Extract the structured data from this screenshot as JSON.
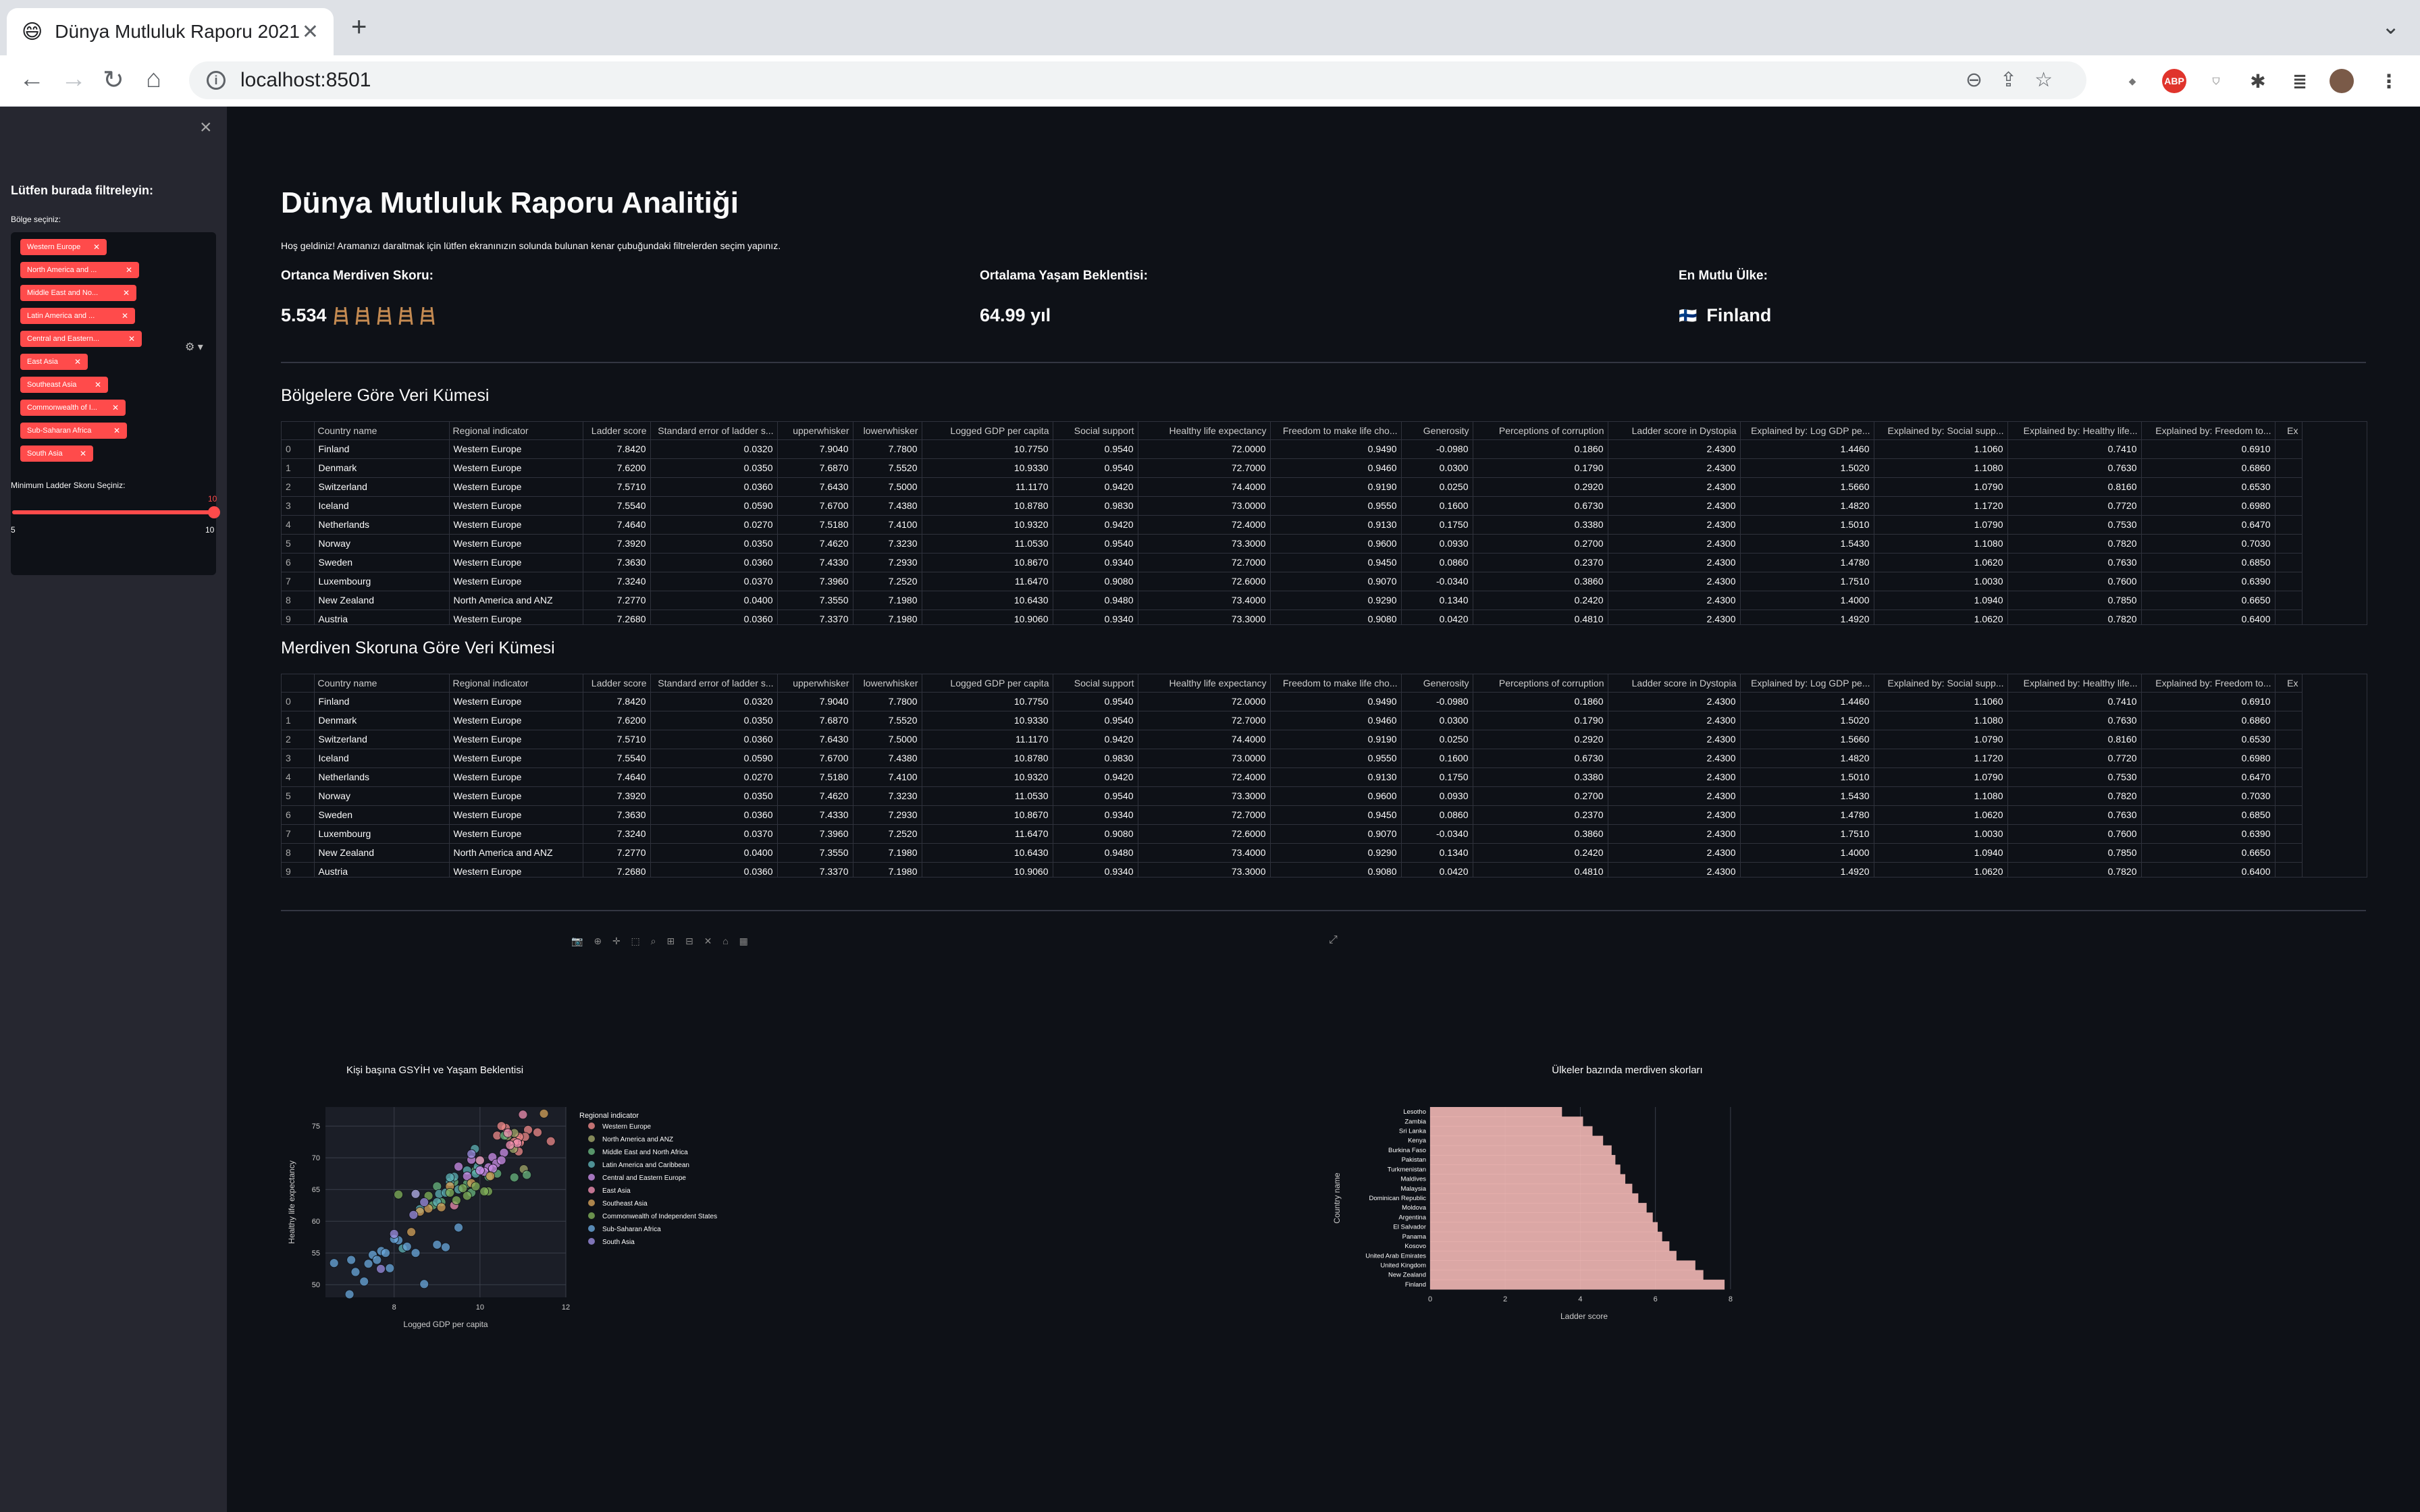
{
  "browser": {
    "tab_title": "Dünya Mutluluk Raporu 2021",
    "tab_favicon": "😄",
    "url": "localhost:8501",
    "ext_abp": "ABP"
  },
  "sidebar": {
    "title": "Lütfen burada filtreleyin:",
    "region_label": "Bölge seçiniz:",
    "regions": [
      "Western Europe",
      "North America and ...",
      "Middle East and No...",
      "Latin America and ...",
      "Central and Eastern...",
      "East Asia",
      "Southeast Asia",
      "Commonwealth of I...",
      "Sub-Saharan Africa",
      "South Asia"
    ],
    "ladder_label": "Minimum Ladder Skoru Seçiniz:",
    "slider_value": "10",
    "slider_min": "5",
    "slider_max": "10"
  },
  "main": {
    "title": "Dünya Mutluluk Raporu Analitiği",
    "welcome": "Hoş geldiniz! Aramanızı daraltmak için lütfen ekranınızın solunda bulunan kenar çubuğundaki filtrelerden seçim yapınız.",
    "kpi1_label": "Ortanca Merdiven Skoru:",
    "kpi1_value": "5.534",
    "kpi2_label": "Ortalama Yaşam Beklentisi:",
    "kpi2_value": "64.99 yıl",
    "kpi3_label": "En Mutlu Ülke:",
    "kpi3_flag": "🇫🇮",
    "kpi3_value": "Finland",
    "table1_title": "Bölgelere Göre Veri Kümesi",
    "table2_title": "Merdiven Skoruna Göre Veri Kümesi"
  },
  "table": {
    "columns": [
      "",
      "Country name",
      "Regional indicator",
      "Ladder score",
      "Standard error of ladder s...",
      "upperwhisker",
      "lowerwhisker",
      "Logged GDP per capita",
      "Social support",
      "Healthy life expectancy",
      "Freedom to make life cho...",
      "Generosity",
      "Perceptions of corruption",
      "Ladder score in Dystopia",
      "Explained by: Log GDP pe...",
      "Explained by: Social supp...",
      "Explained by: Healthy life...",
      "Explained by: Freedom to...",
      "Ex"
    ],
    "rows": [
      [
        "0",
        "Finland",
        "Western Europe",
        "7.8420",
        "0.0320",
        "7.9040",
        "7.7800",
        "10.7750",
        "0.9540",
        "72.0000",
        "0.9490",
        "-0.0980",
        "0.1860",
        "2.4300",
        "1.4460",
        "1.1060",
        "0.7410",
        "0.6910",
        ""
      ],
      [
        "1",
        "Denmark",
        "Western Europe",
        "7.6200",
        "0.0350",
        "7.6870",
        "7.5520",
        "10.9330",
        "0.9540",
        "72.7000",
        "0.9460",
        "0.0300",
        "0.1790",
        "2.4300",
        "1.5020",
        "1.1080",
        "0.7630",
        "0.6860",
        ""
      ],
      [
        "2",
        "Switzerland",
        "Western Europe",
        "7.5710",
        "0.0360",
        "7.6430",
        "7.5000",
        "11.1170",
        "0.9420",
        "74.4000",
        "0.9190",
        "0.0250",
        "0.2920",
        "2.4300",
        "1.5660",
        "1.0790",
        "0.8160",
        "0.6530",
        ""
      ],
      [
        "3",
        "Iceland",
        "Western Europe",
        "7.5540",
        "0.0590",
        "7.6700",
        "7.4380",
        "10.8780",
        "0.9830",
        "73.0000",
        "0.9550",
        "0.1600",
        "0.6730",
        "2.4300",
        "1.4820",
        "1.1720",
        "0.7720",
        "0.6980",
        ""
      ],
      [
        "4",
        "Netherlands",
        "Western Europe",
        "7.4640",
        "0.0270",
        "7.5180",
        "7.4100",
        "10.9320",
        "0.9420",
        "72.4000",
        "0.9130",
        "0.1750",
        "0.3380",
        "2.4300",
        "1.5010",
        "1.0790",
        "0.7530",
        "0.6470",
        ""
      ],
      [
        "5",
        "Norway",
        "Western Europe",
        "7.3920",
        "0.0350",
        "7.4620",
        "7.3230",
        "11.0530",
        "0.9540",
        "73.3000",
        "0.9600",
        "0.0930",
        "0.2700",
        "2.4300",
        "1.5430",
        "1.1080",
        "0.7820",
        "0.7030",
        ""
      ],
      [
        "6",
        "Sweden",
        "Western Europe",
        "7.3630",
        "0.0360",
        "7.4330",
        "7.2930",
        "10.8670",
        "0.9340",
        "72.7000",
        "0.9450",
        "0.0860",
        "0.2370",
        "2.4300",
        "1.4780",
        "1.0620",
        "0.7630",
        "0.6850",
        ""
      ],
      [
        "7",
        "Luxembourg",
        "Western Europe",
        "7.3240",
        "0.0370",
        "7.3960",
        "7.2520",
        "11.6470",
        "0.9080",
        "72.6000",
        "0.9070",
        "-0.0340",
        "0.3860",
        "2.4300",
        "1.7510",
        "1.0030",
        "0.7600",
        "0.6390",
        ""
      ],
      [
        "8",
        "New Zealand",
        "North America and ANZ",
        "7.2770",
        "0.0400",
        "7.3550",
        "7.1980",
        "10.6430",
        "0.9480",
        "73.4000",
        "0.9290",
        "0.1340",
        "0.2420",
        "2.4300",
        "1.4000",
        "1.0940",
        "0.7850",
        "0.6650",
        ""
      ],
      [
        "9",
        "Austria",
        "Western Europe",
        "7.2680",
        "0.0360",
        "7.3370",
        "7.1980",
        "10.9060",
        "0.9340",
        "73.3000",
        "0.9080",
        "0.0420",
        "0.4810",
        "2.4300",
        "1.4920",
        "1.0620",
        "0.7820",
        "0.6400",
        ""
      ]
    ]
  },
  "scatter": {
    "title": "Kişi başına GSYİH ve Yaşam Beklentisi",
    "xlabel": "Logged GDP per capita",
    "ylabel": "Healthy life expectancy",
    "legend_title": "Regional indicator",
    "xticks": [
      "8",
      "10",
      "12"
    ],
    "yticks": [
      "75",
      "70",
      "65",
      "60",
      "55",
      "50"
    ],
    "legend": [
      {
        "name": "Western Europe",
        "color": "#ef8a8a"
      },
      {
        "name": "North America and ANZ",
        "color": "#a3a86a"
      },
      {
        "name": "Middle East and North Africa",
        "color": "#6ab77f"
      },
      {
        "name": "Latin America and Caribbean",
        "color": "#5fb1b5"
      },
      {
        "name": "Central and Eastern Europe",
        "color": "#cc8ee8"
      },
      {
        "name": "East Asia",
        "color": "#f08fb2"
      },
      {
        "name": "Southeast Asia",
        "color": "#d6a35a"
      },
      {
        "name": "Commonwealth of Independent States",
        "color": "#82b15a"
      },
      {
        "name": "Sub-Saharan Africa",
        "color": "#6aa8dc"
      },
      {
        "name": "South Asia",
        "color": "#9c8de0"
      }
    ]
  },
  "barchart": {
    "title": "Ülkeler bazında merdiven skorları",
    "xlabel": "Ladder score",
    "ylabel": "Country name",
    "xticks": [
      "0",
      "2",
      "4",
      "6",
      "8"
    ],
    "country_labels": [
      "Lesotho",
      "Zambia",
      "Sri Lanka",
      "Kenya",
      "Burkina Faso",
      "Pakistan",
      "Turkmenistan",
      "Maldives",
      "Malaysia",
      "Dominican Republic",
      "Moldova",
      "Argentina",
      "El Salvador",
      "Panama",
      "Kosovo",
      "United Arab Emirates",
      "United Kingdom",
      "New Zealand",
      "Finland"
    ]
  },
  "chart_data": [
    {
      "type": "scatter",
      "title": "Kişi başına GSYİH ve Yaşam Beklentisi",
      "xlabel": "Logged GDP per capita",
      "ylabel": "Healthy life expectancy",
      "xlim": [
        6.4,
        12
      ],
      "ylim": [
        48,
        78
      ],
      "series": [
        {
          "name": "Western Europe",
          "points": [
            [
              10.78,
              72.0
            ],
            [
              10.93,
              72.7
            ],
            [
              11.12,
              74.4
            ],
            [
              10.88,
              73.0
            ],
            [
              10.93,
              72.4
            ],
            [
              11.05,
              73.3
            ],
            [
              10.87,
              72.7
            ],
            [
              11.65,
              72.6
            ],
            [
              10.91,
              73.3
            ],
            [
              11.34,
              74.0
            ],
            [
              10.6,
              74.7
            ],
            [
              10.5,
              75.0
            ],
            [
              10.8,
              72.5
            ],
            [
              10.4,
              73.5
            ],
            [
              10.9,
              71.0
            ]
          ]
        },
        {
          "name": "North America and ANZ",
          "points": [
            [
              10.64,
              73.4
            ],
            [
              10.8,
              73.9
            ],
            [
              11.02,
              68.2
            ],
            [
              10.78,
              71.4
            ]
          ]
        },
        {
          "name": "Middle East and North Africa",
          "points": [
            [
              10.57,
              73.5
            ],
            [
              11.09,
              67.3
            ],
            [
              10.8,
              66.9
            ],
            [
              9.9,
              68.0
            ],
            [
              10.2,
              67.0
            ],
            [
              9.0,
              65.5
            ],
            [
              9.7,
              65.9
            ],
            [
              9.4,
              66.2
            ],
            [
              9.1,
              63.0
            ],
            [
              8.9,
              62.5
            ],
            [
              10.4,
              67.5
            ],
            [
              9.8,
              64.5
            ]
          ]
        },
        {
          "name": "Latin America and Caribbean",
          "points": [
            [
              9.88,
              71.4
            ],
            [
              9.95,
              68.6
            ],
            [
              9.3,
              66.2
            ],
            [
              9.05,
              64.3
            ],
            [
              9.9,
              67.5
            ],
            [
              9.7,
              68.0
            ],
            [
              9.2,
              64.5
            ],
            [
              8.6,
              61.9
            ],
            [
              9.0,
              63.0
            ],
            [
              10.0,
              69.5
            ],
            [
              9.5,
              65.0
            ],
            [
              8.2,
              55.7
            ],
            [
              9.4,
              67.0
            ],
            [
              9.3,
              66.9
            ]
          ]
        },
        {
          "name": "Central and Eastern Europe",
          "points": [
            [
              10.56,
              70.8
            ],
            [
              10.29,
              70.1
            ],
            [
              10.38,
              69.1
            ],
            [
              10.5,
              69.6
            ],
            [
              10.2,
              68.5
            ],
            [
              10.1,
              67.8
            ],
            [
              9.7,
              67.1
            ],
            [
              10.0,
              68.0
            ],
            [
              10.3,
              68.3
            ],
            [
              9.5,
              68.6
            ],
            [
              9.8,
              69.7
            ]
          ]
        },
        {
          "name": "East Asia",
          "points": [
            [
              10.87,
              72.3
            ],
            [
              10.65,
              73.9
            ],
            [
              11.0,
              76.8
            ],
            [
              10.0,
              69.6
            ],
            [
              9.4,
              62.5
            ],
            [
              10.7,
              72.0
            ]
          ]
        },
        {
          "name": "Southeast Asia",
          "points": [
            [
              11.49,
              76.95
            ],
            [
              10.24,
              67.1
            ],
            [
              9.8,
              66.0
            ],
            [
              9.1,
              62.2
            ],
            [
              8.8,
              62.0
            ],
            [
              9.3,
              65.5
            ],
            [
              8.4,
              58.3
            ],
            [
              8.6,
              61.5
            ]
          ]
        },
        {
          "name": "Commonwealth of Independent States",
          "points": [
            [
              10.19,
              64.7
            ],
            [
              9.7,
              64.0
            ],
            [
              9.3,
              64.5
            ],
            [
              8.5,
              64.3
            ],
            [
              8.1,
              64.2
            ],
            [
              9.6,
              65.2
            ],
            [
              9.9,
              65.5
            ],
            [
              10.1,
              64.7
            ],
            [
              8.8,
              64.0
            ],
            [
              9.45,
              63.3
            ]
          ]
        },
        {
          "name": "Sub-Saharan Africa",
          "points": [
            [
              9.0,
              56.3
            ],
            [
              7.7,
              55.3
            ],
            [
              6.96,
              48.48
            ],
            [
              7.4,
              53.3
            ],
            [
              7.8,
              55.0
            ],
            [
              8.3,
              56.0
            ],
            [
              7.0,
              53.9
            ],
            [
              8.7,
              50.1
            ],
            [
              9.2,
              55.9
            ],
            [
              7.9,
              52.6
            ],
            [
              7.5,
              54.7
            ],
            [
              8.1,
              57.0
            ],
            [
              7.3,
              50.5
            ],
            [
              7.6,
              53.9
            ],
            [
              8.5,
              55.0
            ],
            [
              7.1,
              52.0
            ],
            [
              9.5,
              59.0
            ],
            [
              6.6,
              53.4
            ],
            [
              8.0,
              57.2
            ]
          ]
        },
        {
          "name": "South Asia",
          "points": [
            [
              7.69,
              52.49
            ],
            [
              8.0,
              58.0
            ],
            [
              9.8,
              70.6
            ],
            [
              8.5,
              64.3
            ],
            [
              8.45,
              61.0
            ],
            [
              8.7,
              63.0
            ]
          ]
        }
      ]
    },
    {
      "type": "bar",
      "orientation": "horizontal",
      "title": "Ülkeler bazında merdiven skorları",
      "xlabel": "Ladder score",
      "ylabel": "Country name",
      "xlim": [
        0,
        8.2
      ],
      "categories": [
        "Lesotho",
        "Zambia",
        "Sri Lanka",
        "Kenya",
        "Burkina Faso",
        "Pakistan",
        "Turkmenistan",
        "Maldives",
        "Malaysia",
        "Dominican Republic",
        "Moldova",
        "Argentina",
        "El Salvador",
        "Panama",
        "Kosovo",
        "United Arab Emirates",
        "United Kingdom",
        "New Zealand",
        "Finland"
      ],
      "values": [
        3.512,
        4.073,
        4.325,
        4.607,
        4.834,
        4.934,
        5.066,
        5.198,
        5.384,
        5.545,
        5.766,
        5.929,
        6.061,
        6.18,
        6.372,
        6.561,
        7.064,
        7.277,
        7.842
      ]
    }
  ]
}
